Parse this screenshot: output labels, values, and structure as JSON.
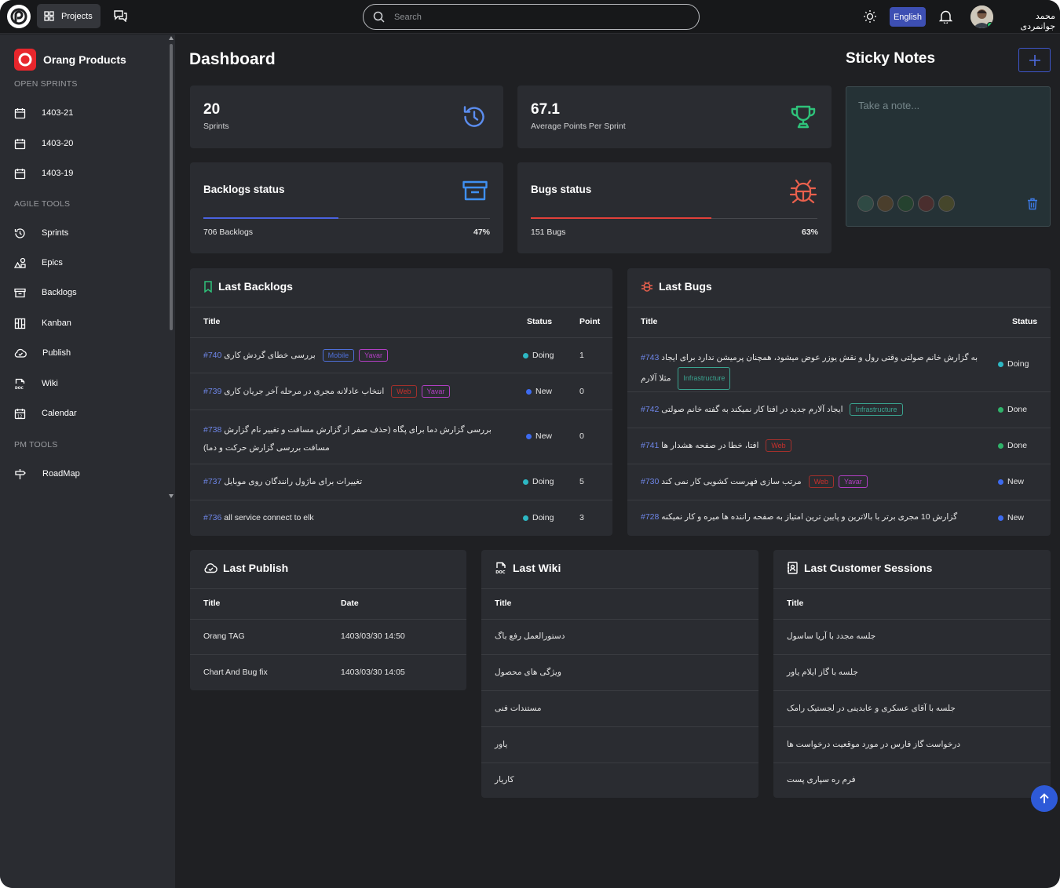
{
  "header": {
    "projects_label": "Projects",
    "search_placeholder": "Search",
    "language": "English",
    "user_name": "محمد جوانمردی"
  },
  "sidebar": {
    "org_name": "Orang Products",
    "open_sprints_title": "OPEN SPRINTS",
    "sprints": [
      "1403-21",
      "1403-20",
      "1403-19"
    ],
    "agile_tools_title": "AGILE TOOLS",
    "agile_tools": [
      "Sprints",
      "Epics",
      "Backlogs",
      "Kanban",
      "Publish",
      "Wiki",
      "Calendar"
    ],
    "pm_tools_title": "PM TOOLS",
    "pm_tools": [
      "RoadMap"
    ]
  },
  "dashboard": {
    "title": "Dashboard",
    "sprints_count": "20",
    "sprints_label": "Sprints",
    "avg_points": "67.1",
    "avg_points_label": "‎Average Points Per Sprint",
    "backlogs_status": {
      "title": "Backlogs status",
      "count_label": "706 Backlogs",
      "percent_label": "47%",
      "percent": 47
    },
    "bugs_status": {
      "title": "Bugs status",
      "count_label": "151 Bugs",
      "percent_label": "63%",
      "percent": 63
    }
  },
  "last_backlogs": {
    "title": "Last Backlogs",
    "columns": [
      "Title",
      "Status",
      "Point"
    ],
    "rows": [
      {
        "id": "#740",
        "title": "بررسی خطای گردش کاری",
        "tags": [
          "Mobile",
          "Yavar"
        ],
        "status": "Doing",
        "point": "1"
      },
      {
        "id": "#739",
        "title": "انتخاب عادلانه مجری در مرحله آخر جریان کاری",
        "tags": [
          "Web",
          "Yavar"
        ],
        "status": "New",
        "point": "0"
      },
      {
        "id": "#738",
        "title": "بررسی گزارش دما برای پگاه (حذف صفر از گزارش مسافت و تغییر نام گزارش مسافت بررسی گزارش حرکت و دما)",
        "tags": [],
        "status": "New",
        "point": "0"
      },
      {
        "id": "#737",
        "title": "تغییرات برای ماژول رانندگان روی موبایل",
        "tags": [],
        "status": "Doing",
        "point": "5"
      },
      {
        "id": "#736",
        "title": "all service connect to elk",
        "tags": [],
        "status": "Doing",
        "point": "3"
      }
    ]
  },
  "last_bugs": {
    "title": "Last Bugs",
    "columns": [
      "Title",
      "Status"
    ],
    "rows": [
      {
        "id": "#743",
        "title": "به گزارش خانم صولتی وقتی رول و نقش یوزر عوض میشود، همچنان پرمیشن ندارد برای ایجاد مثلا آلارم",
        "tags": [
          "Infrastructure"
        ],
        "status": "Doing"
      },
      {
        "id": "#742",
        "title": "ایجاد آلارم جدید در افتا کار نمیکند به گفته خانم صولتی",
        "tags": [
          "Infrastructure"
        ],
        "status": "Done"
      },
      {
        "id": "#741",
        "title": "افتا، خطا در صفحه هشدار ها",
        "tags": [
          "Web"
        ],
        "status": "Done"
      },
      {
        "id": "#730",
        "title": "مرتب سازی فهرست کشویی کار نمی کند",
        "tags": [
          "Web",
          "Yavar"
        ],
        "status": "New"
      },
      {
        "id": "#728",
        "title": "گزارش 10 مجری برتر با بالاترین و پایین ترین امتیاز به صفحه راننده ها میره و کار نمیکنه",
        "tags": [],
        "status": "New"
      }
    ]
  },
  "last_publish": {
    "title": "Last Publish",
    "columns": [
      "Title",
      "Date"
    ],
    "rows": [
      {
        "title": "Orang TAG",
        "date": "1403/03/30 14:50"
      },
      {
        "title": "Chart And Bug fix",
        "date": "1403/03/30 14:05"
      }
    ]
  },
  "last_wiki": {
    "title": "Last Wiki",
    "columns": [
      "Title"
    ],
    "rows": [
      "دستورالعمل رفع باگ",
      "ویژگی های محصول",
      "مستندات فنی",
      "یاور",
      "کاریار"
    ]
  },
  "last_sessions": {
    "title": "Last Customer Sessions",
    "columns": [
      "Title"
    ],
    "rows": [
      "جلسه مجدد با آریا ساسول",
      "جلسه با گاز ایلام یاور",
      "جلسه با آقای عسکری و عابدینی در لجستیک رامک",
      "درخواست گاز فارس در مورد موقعیت درخواست ها",
      "فرم ره سپاری پست"
    ]
  },
  "sticky": {
    "title": "Sticky Notes",
    "placeholder": "Take a note...",
    "swatches": [
      "#2f4a44",
      "#4a3e2c",
      "#25422f",
      "#4a2e2e",
      "#45462b"
    ]
  },
  "colors": {
    "accent": "#3d55c9",
    "doing": "#2db8c4",
    "new": "#3d6bf0",
    "done": "#2fb36a",
    "backlog_bar": "#4a62e0",
    "bug_bar": "#e2403a"
  }
}
